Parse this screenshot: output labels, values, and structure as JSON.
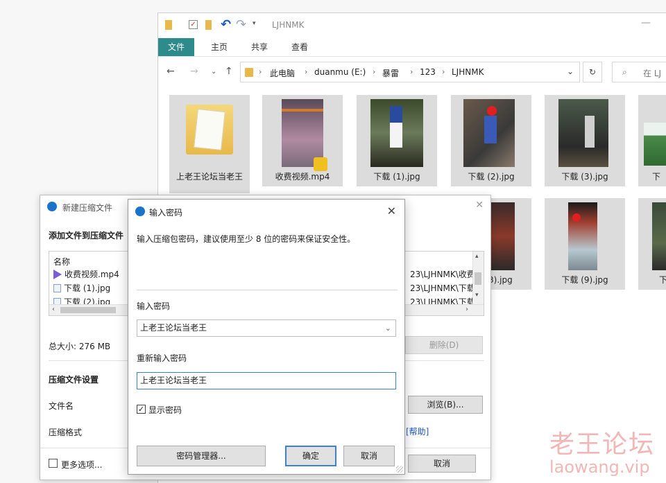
{
  "explorer": {
    "window_title": "LJHNMK",
    "tabs": [
      "文件",
      "主页",
      "共享",
      "查看"
    ],
    "breadcrumb": [
      "此电脑",
      "duanmu (E:)",
      "暴雷",
      "123",
      "LJHNMK"
    ],
    "search_placeholder": "在 LJ",
    "items_row1": [
      {
        "name": "上老王论坛当老王",
        "type": "folder"
      },
      {
        "name": "收费视频.mp4",
        "type": "video"
      },
      {
        "name": "下载 (1).jpg",
        "type": "image"
      },
      {
        "name": "下载 (2).jpg",
        "type": "image"
      },
      {
        "name": "下载 (3).jpg",
        "type": "image"
      },
      {
        "name": "下",
        "type": "image"
      }
    ],
    "items_row2_visible": [
      {
        "name": "3).jpg",
        "type": "image"
      },
      {
        "name": "下载 (9).jpg",
        "type": "image"
      },
      {
        "name": "下",
        "type": "image"
      }
    ]
  },
  "compress_dialog": {
    "title": "新建压缩文件",
    "add_files_label": "添加文件到压缩文件",
    "column_name": "名称",
    "files": [
      {
        "name": "收费视频.mp4",
        "path": "23\\LJHNMK\\收费"
      },
      {
        "name": "下载 (1).jpg",
        "path": "23\\LJHNMK\\下载"
      },
      {
        "name": "下载 (2).jpg",
        "path": "23\\LJHNMK\\下载"
      }
    ],
    "total_size": "总大小: 276 MB",
    "delete_button": "删除(D)",
    "settings_heading": "压缩文件设置",
    "filename_label": "文件名",
    "browse_button": "浏览(B)...",
    "format_label": "压缩格式",
    "help_link": "[帮助]",
    "more_options": "更多选项...",
    "cancel_button": "取消"
  },
  "password_dialog": {
    "title": "输入密码",
    "hint": "输入压缩包密码，建议使用至少 8 位的密码来保证安全性。",
    "password_label": "输入密码",
    "password_value": "上老王论坛当老王",
    "reenter_label": "重新输入密码",
    "reenter_value": "上老王论坛当老王",
    "show_password_label": "显示密码",
    "show_password_checked": true,
    "manager_button": "密码管理器...",
    "ok_button": "确定",
    "cancel_button": "取消"
  },
  "watermark": {
    "line1": "老王论坛",
    "line2": "laowang.vip"
  }
}
